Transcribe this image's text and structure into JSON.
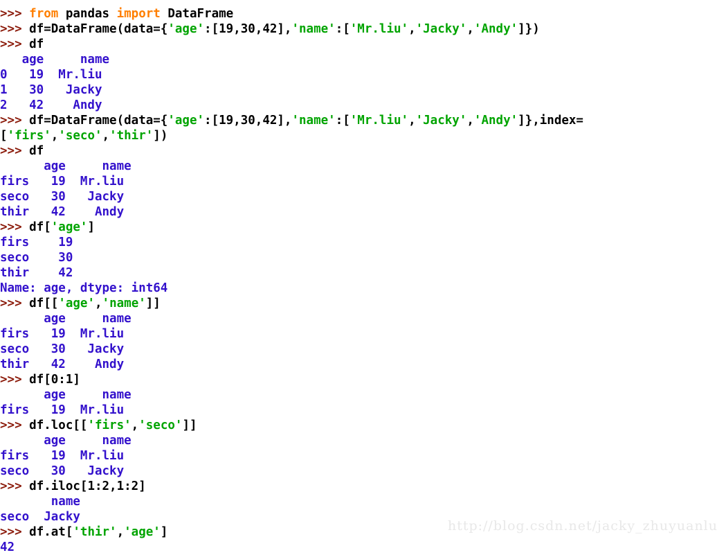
{
  "window": {
    "title": "Python Console — pandas DataFrame",
    "background": "#ffffff"
  },
  "colors": {
    "prompt": "#8B1A0A",
    "keyword": "#FF7F00",
    "code": "#000000",
    "string": "#00A400",
    "output": "#3311CC",
    "watermark": "#E8E8E8"
  },
  "prompt_symbol": ">>> ",
  "watermark": {
    "text": "http://blog.csdn.net/jacky_zhuyuanlu"
  },
  "lines": [
    {
      "id": "l00",
      "type": "input-clipped",
      "text": ""
    },
    {
      "id": "l01",
      "type": "input",
      "prompt": ">>> ",
      "segments": [
        {
          "cls": "kw",
          "t": "from"
        },
        {
          "cls": "code",
          "t": " pandas "
        },
        {
          "cls": "kw",
          "t": "import"
        },
        {
          "cls": "code",
          "t": " DataFrame"
        }
      ]
    },
    {
      "id": "l02",
      "type": "input",
      "prompt": ">>> ",
      "segments": [
        {
          "cls": "code",
          "t": "df=DataFrame(data={"
        },
        {
          "cls": "str",
          "t": "'age'"
        },
        {
          "cls": "code",
          "t": ":[19,30,42],"
        },
        {
          "cls": "str",
          "t": "'name'"
        },
        {
          "cls": "code",
          "t": ":["
        },
        {
          "cls": "str",
          "t": "'Mr.liu'"
        },
        {
          "cls": "code",
          "t": ","
        },
        {
          "cls": "str",
          "t": "'Jacky'"
        },
        {
          "cls": "code",
          "t": ","
        },
        {
          "cls": "str",
          "t": "'Andy'"
        },
        {
          "cls": "code",
          "t": "]})"
        }
      ]
    },
    {
      "id": "l03",
      "type": "input",
      "prompt": ">>> ",
      "segments": [
        {
          "cls": "code",
          "t": "df"
        }
      ]
    },
    {
      "id": "l04",
      "type": "output",
      "segments": [
        {
          "cls": "out",
          "t": "   age     name"
        }
      ]
    },
    {
      "id": "l05",
      "type": "output",
      "segments": [
        {
          "cls": "out",
          "t": "0   19  Mr.liu"
        }
      ]
    },
    {
      "id": "l06",
      "type": "output",
      "segments": [
        {
          "cls": "out",
          "t": "1   30   Jacky"
        }
      ]
    },
    {
      "id": "l07",
      "type": "output",
      "segments": [
        {
          "cls": "out",
          "t": "2   42    Andy"
        }
      ]
    },
    {
      "id": "l08",
      "type": "input",
      "prompt": ">>> ",
      "segments": [
        {
          "cls": "code",
          "t": "df=DataFrame(data={"
        },
        {
          "cls": "str",
          "t": "'age'"
        },
        {
          "cls": "code",
          "t": ":[19,30,42],"
        },
        {
          "cls": "str",
          "t": "'name'"
        },
        {
          "cls": "code",
          "t": ":["
        },
        {
          "cls": "str",
          "t": "'Mr.liu'"
        },
        {
          "cls": "code",
          "t": ","
        },
        {
          "cls": "str",
          "t": "'Jacky'"
        },
        {
          "cls": "code",
          "t": ","
        },
        {
          "cls": "str",
          "t": "'Andy'"
        },
        {
          "cls": "code",
          "t": "]},index="
        }
      ]
    },
    {
      "id": "l09",
      "type": "input-cont",
      "segments": [
        {
          "cls": "code",
          "t": "["
        },
        {
          "cls": "str",
          "t": "'firs'"
        },
        {
          "cls": "code",
          "t": ","
        },
        {
          "cls": "str",
          "t": "'seco'"
        },
        {
          "cls": "code",
          "t": ","
        },
        {
          "cls": "str",
          "t": "'thir'"
        },
        {
          "cls": "code",
          "t": "])"
        }
      ]
    },
    {
      "id": "l10",
      "type": "input",
      "prompt": ">>> ",
      "segments": [
        {
          "cls": "code",
          "t": "df"
        }
      ]
    },
    {
      "id": "l11",
      "type": "output",
      "segments": [
        {
          "cls": "out",
          "t": "      age     name"
        }
      ]
    },
    {
      "id": "l12",
      "type": "output",
      "segments": [
        {
          "cls": "out",
          "t": "firs   19  Mr.liu"
        }
      ]
    },
    {
      "id": "l13",
      "type": "output",
      "segments": [
        {
          "cls": "out",
          "t": "seco   30   Jacky"
        }
      ]
    },
    {
      "id": "l14",
      "type": "output",
      "segments": [
        {
          "cls": "out",
          "t": "thir   42    Andy"
        }
      ]
    },
    {
      "id": "l15",
      "type": "input",
      "prompt": ">>> ",
      "segments": [
        {
          "cls": "code",
          "t": "df["
        },
        {
          "cls": "str",
          "t": "'age'"
        },
        {
          "cls": "code",
          "t": "]"
        }
      ]
    },
    {
      "id": "l16",
      "type": "output",
      "segments": [
        {
          "cls": "out",
          "t": "firs    19"
        }
      ]
    },
    {
      "id": "l17",
      "type": "output",
      "segments": [
        {
          "cls": "out",
          "t": "seco    30"
        }
      ]
    },
    {
      "id": "l18",
      "type": "output",
      "segments": [
        {
          "cls": "out",
          "t": "thir    42"
        }
      ]
    },
    {
      "id": "l19",
      "type": "output",
      "segments": [
        {
          "cls": "out",
          "t": "Name: age, dtype: int64"
        }
      ]
    },
    {
      "id": "l20",
      "type": "input",
      "prompt": ">>> ",
      "segments": [
        {
          "cls": "code",
          "t": "df[["
        },
        {
          "cls": "str",
          "t": "'age'"
        },
        {
          "cls": "code",
          "t": ","
        },
        {
          "cls": "str",
          "t": "'name'"
        },
        {
          "cls": "code",
          "t": "]]"
        }
      ]
    },
    {
      "id": "l21",
      "type": "output",
      "segments": [
        {
          "cls": "out",
          "t": "      age     name"
        }
      ]
    },
    {
      "id": "l22",
      "type": "output",
      "segments": [
        {
          "cls": "out",
          "t": "firs   19  Mr.liu"
        }
      ]
    },
    {
      "id": "l23",
      "type": "output",
      "segments": [
        {
          "cls": "out",
          "t": "seco   30   Jacky"
        }
      ]
    },
    {
      "id": "l24",
      "type": "output",
      "segments": [
        {
          "cls": "out",
          "t": "thir   42    Andy"
        }
      ]
    },
    {
      "id": "l25",
      "type": "input",
      "prompt": ">>> ",
      "segments": [
        {
          "cls": "code",
          "t": "df[0:1]"
        }
      ]
    },
    {
      "id": "l26",
      "type": "output",
      "segments": [
        {
          "cls": "out",
          "t": "      age     name"
        }
      ]
    },
    {
      "id": "l27",
      "type": "output",
      "segments": [
        {
          "cls": "out",
          "t": "firs   19  Mr.liu"
        }
      ]
    },
    {
      "id": "l28",
      "type": "input",
      "prompt": ">>> ",
      "segments": [
        {
          "cls": "code",
          "t": "df.loc[["
        },
        {
          "cls": "str",
          "t": "'firs'"
        },
        {
          "cls": "code",
          "t": ","
        },
        {
          "cls": "str",
          "t": "'seco'"
        },
        {
          "cls": "code",
          "t": "]]"
        }
      ]
    },
    {
      "id": "l29",
      "type": "output",
      "segments": [
        {
          "cls": "out",
          "t": "      age     name"
        }
      ]
    },
    {
      "id": "l30",
      "type": "output",
      "segments": [
        {
          "cls": "out",
          "t": "firs   19  Mr.liu"
        }
      ]
    },
    {
      "id": "l31",
      "type": "output",
      "segments": [
        {
          "cls": "out",
          "t": "seco   30   Jacky"
        }
      ]
    },
    {
      "id": "l32",
      "type": "input",
      "prompt": ">>> ",
      "segments": [
        {
          "cls": "code",
          "t": "df.iloc[1:2,1:2]"
        }
      ]
    },
    {
      "id": "l33",
      "type": "output",
      "segments": [
        {
          "cls": "out",
          "t": "       name"
        }
      ]
    },
    {
      "id": "l34",
      "type": "output",
      "segments": [
        {
          "cls": "out",
          "t": "seco  Jacky"
        }
      ]
    },
    {
      "id": "l35",
      "type": "input",
      "prompt": ">>> ",
      "segments": [
        {
          "cls": "code",
          "t": "df.at["
        },
        {
          "cls": "str",
          "t": "'thir'"
        },
        {
          "cls": "code",
          "t": ","
        },
        {
          "cls": "str",
          "t": "'age'"
        },
        {
          "cls": "code",
          "t": "]"
        }
      ]
    },
    {
      "id": "l36",
      "type": "output",
      "segments": [
        {
          "cls": "out",
          "t": "42"
        }
      ]
    }
  ],
  "dataframes": {
    "df_default_index": {
      "index": [
        "0",
        "1",
        "2"
      ],
      "columns": [
        "age",
        "name"
      ],
      "rows": [
        [
          19,
          "Mr.liu"
        ],
        [
          30,
          "Jacky"
        ],
        [
          42,
          "Andy"
        ]
      ]
    },
    "df_named_index": {
      "index": [
        "firs",
        "seco",
        "thir"
      ],
      "columns": [
        "age",
        "name"
      ],
      "rows": [
        [
          19,
          "Mr.liu"
        ],
        [
          30,
          "Jacky"
        ],
        [
          42,
          "Andy"
        ]
      ]
    },
    "series_age": {
      "index": [
        "firs",
        "seco",
        "thir"
      ],
      "values": [
        19,
        30,
        42
      ],
      "name": "age",
      "dtype": "int64"
    },
    "scalar_at": 42
  }
}
